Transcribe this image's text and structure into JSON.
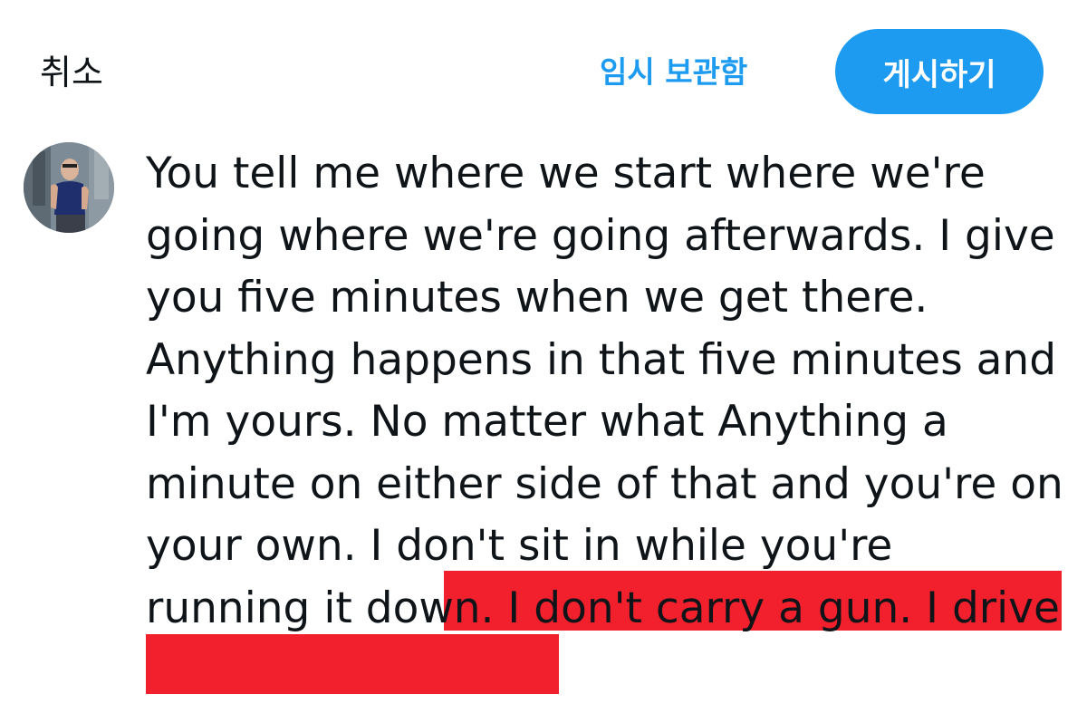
{
  "header": {
    "cancel_label": "취소",
    "drafts_label": "임시 보관함",
    "post_label": "게시하기",
    "accent_color": "#1d9bf0"
  },
  "avatar": {
    "icon": "profile-photo"
  },
  "compose": {
    "text_before_highlight": "You tell me where we start where we're going where we're going afterwards. I give you five minutes when we get there. Anything happens in that five minutes and I'm yours. No matter what Anything a minute on either side of that and you're on your own. I don't sit in while you're r",
    "text_highlighted": "unning it down. I don't carry a gun. I drive",
    "highlight_color": "#f2202c"
  }
}
